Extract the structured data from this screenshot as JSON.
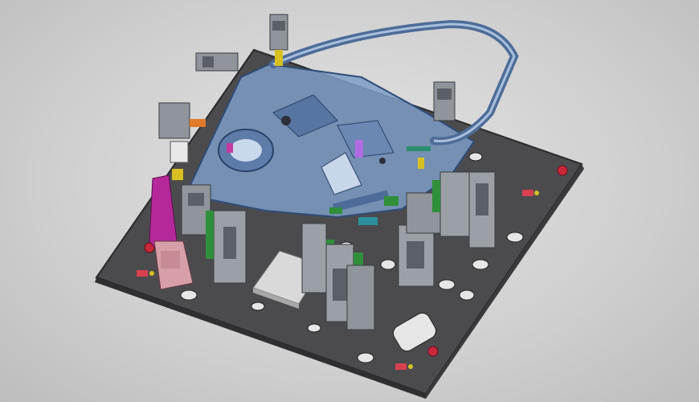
{
  "scene": {
    "subject": "door-checking-fixture-cad-render",
    "colors": {
      "background": "#d4d4d4",
      "base_plate": "#4a4a4c",
      "base_plate_edge": "#2e2e30",
      "door_panel": "#6f8fb8",
      "door_panel_dark": "#3f5f8e",
      "clamp_gray": "#8f959b",
      "clamp_dark": "#5b6066",
      "accent_magenta": "#b4289a",
      "accent_green": "#2f8f3a",
      "accent_yellow": "#d4c020",
      "accent_orange": "#e07a2a",
      "locator_red": "#c8283a",
      "pink_bracket": "#d7a0a8"
    },
    "icons": [
      "clamp-unit",
      "locating-pin",
      "lifting-hole",
      "tag-label"
    ]
  }
}
